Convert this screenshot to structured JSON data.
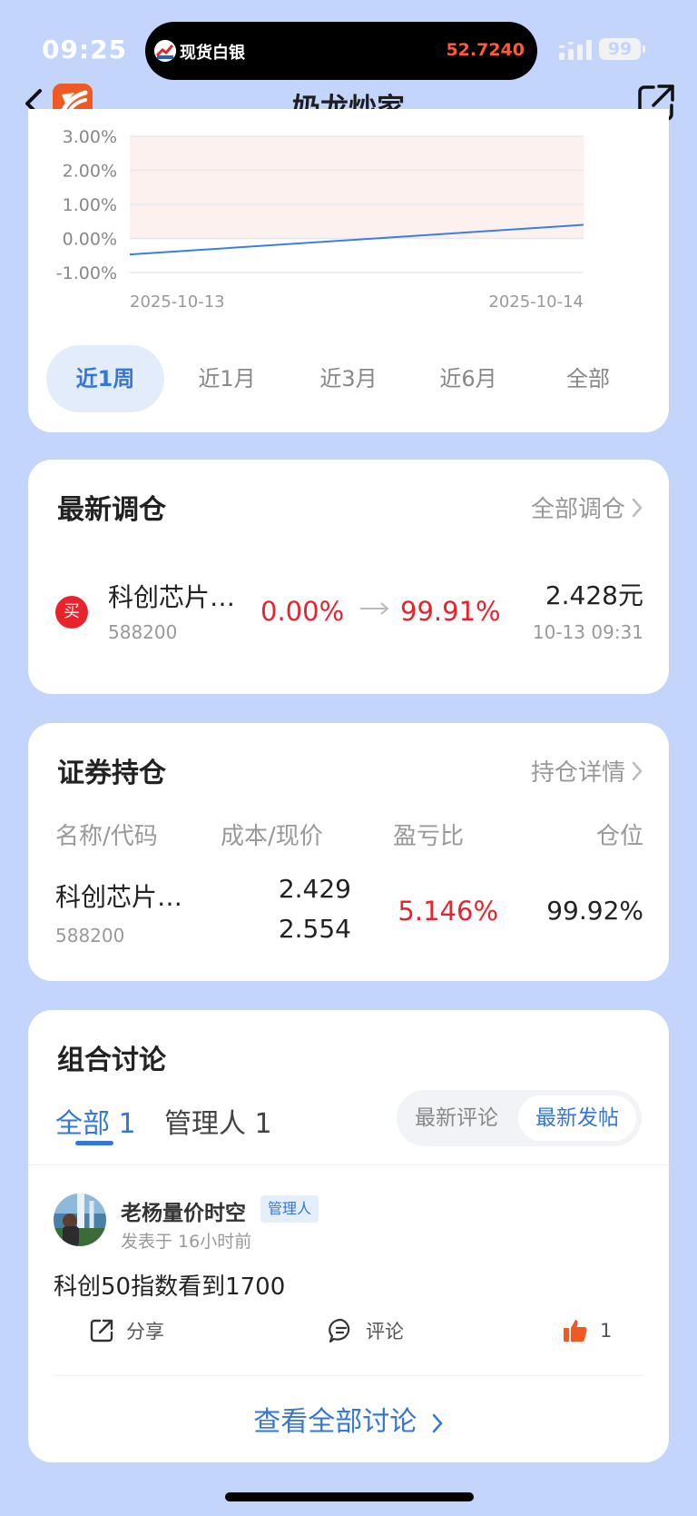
{
  "status_bar": {
    "time": "09:25",
    "ticker_name": "现货白银",
    "ticker_price": "52.7240",
    "battery": "99"
  },
  "nav": {
    "title": "奶龙炒家"
  },
  "chart_data": {
    "type": "line",
    "x": [
      "2025-10-13",
      "2025-10-14"
    ],
    "series": [
      {
        "values": [
          -0.47,
          0.4
        ],
        "color": "#3c7ee0"
      }
    ],
    "yticks": [
      "3.00%",
      "2.00%",
      "1.00%",
      "0.00%",
      "-1.00%"
    ],
    "ylim": [
      -1.0,
      3.0
    ],
    "grid": true,
    "positive_band_color": "#fdf1ef"
  },
  "periods": {
    "items": [
      "近1周",
      "近1月",
      "近3月",
      "近6月",
      "全部"
    ],
    "active": "近1周"
  },
  "trades": {
    "title": "最新调仓",
    "link": "全部调仓",
    "items": [
      {
        "side_badge": "买",
        "name": "科创芯片…",
        "code": "588200",
        "from_weight": "0.00%",
        "to_weight": "99.91%",
        "price": "2.428元",
        "time": "10-13 09:31"
      }
    ]
  },
  "holdings": {
    "title": "证券持仓",
    "link": "持仓详情",
    "headers": {
      "name": "名称/代码",
      "cost": "成本/现价",
      "pl": "盈亏比",
      "position": "仓位"
    },
    "rows": [
      {
        "name": "科创芯片…",
        "code": "588200",
        "cost": "2.429",
        "current": "2.554",
        "pl_ratio": "5.146%",
        "position": "99.92%"
      }
    ]
  },
  "discussion": {
    "title": "组合讨论",
    "tabs": {
      "all": "全部 1",
      "manager": "管理人 1"
    },
    "sort": {
      "latest_comment": "最新评论",
      "latest_post": "最新发帖"
    },
    "posts": [
      {
        "author": "老杨量价时空",
        "role": "管理人",
        "time": "发表于 16小时前",
        "content": "科创50指数看到1700",
        "share_label": "分享",
        "comment_label": "评论",
        "likes": "1"
      }
    ],
    "view_all": "查看全部讨论"
  },
  "colors": {
    "accent": "#3477d6",
    "up_red": "#e8232c",
    "background": "#c3d5fb"
  }
}
